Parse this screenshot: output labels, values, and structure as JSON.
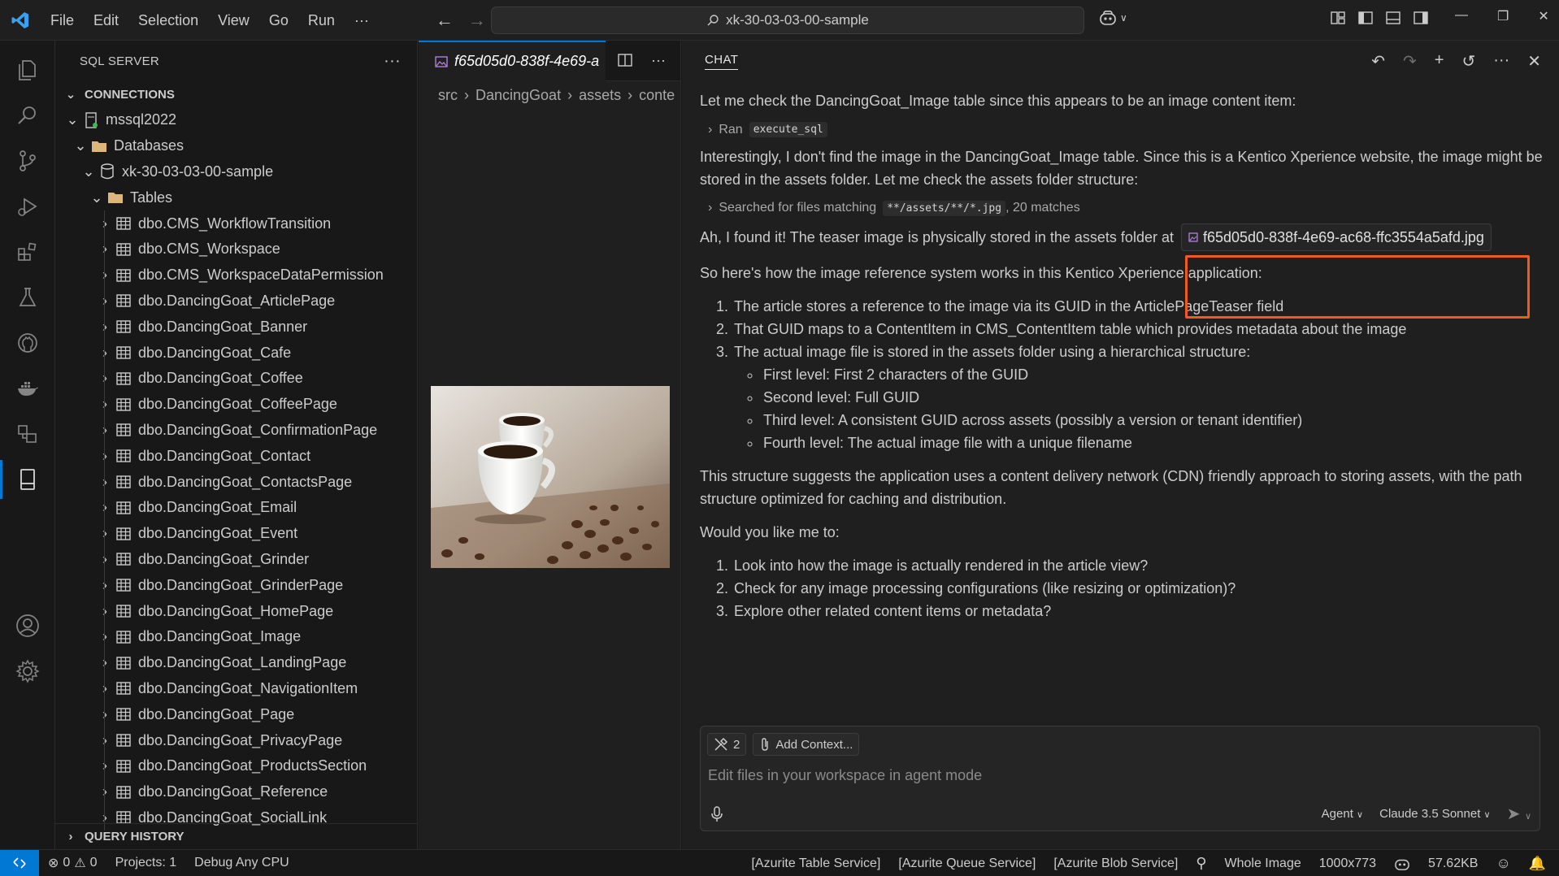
{
  "menu": [
    "File",
    "Edit",
    "Selection",
    "View",
    "Go",
    "Run",
    "···"
  ],
  "command_center": "xk-30-03-03-00-sample",
  "sidebar": {
    "title": "SQL SERVER",
    "more": "···",
    "connections_label": "CONNECTIONS",
    "server": "mssql2022",
    "databases": "Databases",
    "database": "xk-30-03-03-00-sample",
    "tables": "Tables",
    "table_items": [
      "dbo.CMS_WorkflowTransition",
      "dbo.CMS_Workspace",
      "dbo.CMS_WorkspaceDataPermission",
      "dbo.DancingGoat_ArticlePage",
      "dbo.DancingGoat_Banner",
      "dbo.DancingGoat_Cafe",
      "dbo.DancingGoat_Coffee",
      "dbo.DancingGoat_CoffeePage",
      "dbo.DancingGoat_ConfirmationPage",
      "dbo.DancingGoat_Contact",
      "dbo.DancingGoat_ContactsPage",
      "dbo.DancingGoat_Email",
      "dbo.DancingGoat_Event",
      "dbo.DancingGoat_Grinder",
      "dbo.DancingGoat_GrinderPage",
      "dbo.DancingGoat_HomePage",
      "dbo.DancingGoat_Image",
      "dbo.DancingGoat_LandingPage",
      "dbo.DancingGoat_NavigationItem",
      "dbo.DancingGoat_Page",
      "dbo.DancingGoat_PrivacyPage",
      "dbo.DancingGoat_ProductsSection",
      "dbo.DancingGoat_Reference",
      "dbo.DancingGoat_SocialLink"
    ],
    "query_history": "QUERY HISTORY"
  },
  "editor": {
    "tab": "f65d05d0-838f-4e69-a",
    "more": "···",
    "breadcrumb": [
      "src",
      "DancingGoat",
      "assets",
      "conte"
    ]
  },
  "chat": {
    "title": "CHAT",
    "p1": "Let me check the DancingGoat_Image table since this appears to be an image content item:",
    "ran_label": "Ran",
    "ran_code": "execute_sql",
    "p2": "Interestingly, I don't find the image in the DancingGoat_Image table. Since this is a Kentico Xperience website, the image might be stored in the assets folder. Let me check the assets folder structure:",
    "search_prefix": "Searched for files matching",
    "search_code": "**/assets/**/*.jpg",
    "search_suffix": ", 20 matches",
    "p3": "Ah, I found it! The teaser image is physically stored in the assets folder at",
    "file_chip": "f65d05d0-838f-4e69-ac68-ffc3554a5afd.jpg",
    "p4": "So here's how the image reference system works in this Kentico Xperience application:",
    "steps": [
      "The article stores a reference to the image via its GUID in the ArticlePageTeaser field",
      "That GUID maps to a ContentItem in CMS_ContentItem table which provides metadata about the image",
      "The actual image file is stored in the assets folder using a hierarchical structure:"
    ],
    "levels": [
      "First level: First 2 characters of the GUID",
      "Second level: Full GUID",
      "Third level: A consistent GUID across assets (possibly a version or tenant identifier)",
      "Fourth level: The actual image file with a unique filename"
    ],
    "p5": "This structure suggests the application uses a content delivery network (CDN) friendly approach to storing assets, with the path structure optimized for caching and distribution.",
    "p6": "Would you like me to:",
    "options": [
      "Look into how the image is actually rendered in the article view?",
      "Check for any image processing configurations (like resizing or optimization)?",
      "Explore other related content items or metadata?"
    ],
    "tools_count": "2",
    "add_context": "Add Context...",
    "input_placeholder": "Edit files in your workspace in agent mode",
    "mode": "Agent",
    "model": "Claude 3.5 Sonnet"
  },
  "status": {
    "errors": "0",
    "warnings": "0",
    "projects": "Projects: 1",
    "config": "Debug Any CPU",
    "azurite_table": "[Azurite Table Service]",
    "azurite_queue": "[Azurite Queue Service]",
    "azurite_blob": "[Azurite Blob Service]",
    "zoom": "Whole Image",
    "dimensions": "1000x773",
    "size": "57.62KB"
  },
  "colors": {
    "accent": "#0078d4",
    "highlight": "#f05a1d",
    "background": "#1f1f1f"
  }
}
